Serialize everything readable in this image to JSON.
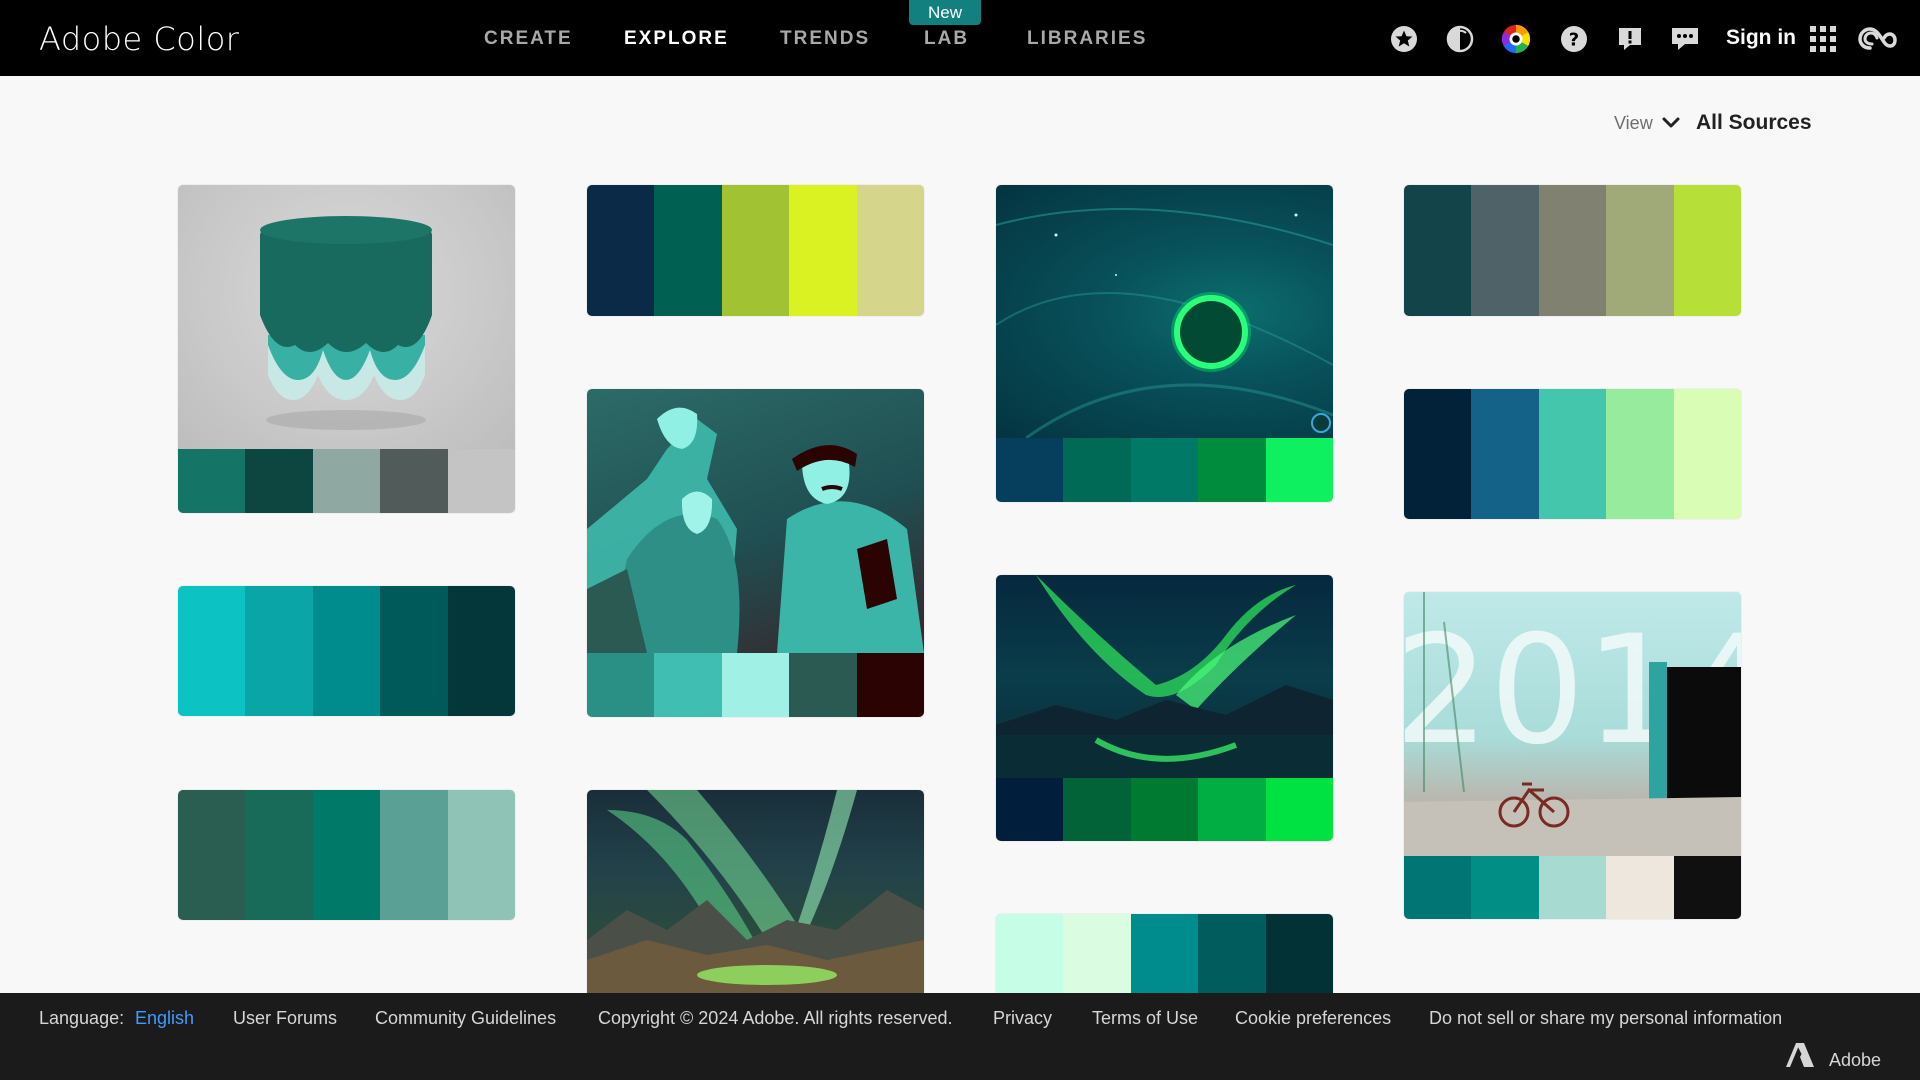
{
  "app": {
    "title": "Adobe Color"
  },
  "nav": {
    "items": [
      {
        "label": "CREATE"
      },
      {
        "label": "EXPLORE"
      },
      {
        "label": "TRENDS"
      },
      {
        "label": "LAB"
      },
      {
        "label": "LIBRARIES"
      }
    ],
    "active": "EXPLORE",
    "lab_badge": "New"
  },
  "header": {
    "icons": [
      "favorites-star-icon",
      "contrast-icon",
      "color-wheel-icon",
      "help-icon",
      "report-icon",
      "feedback-icon"
    ],
    "sign_in": "Sign in"
  },
  "filter": {
    "view_label": "View",
    "source": "All Sources"
  },
  "colors": {
    "background": "#f8f8f8",
    "header": "#000000",
    "footer": "#1b1b1b",
    "badge": "#12807f",
    "link": "#3d9cff"
  },
  "palettes": [
    {
      "image": "teal-stool-render",
      "colors": [
        "#147567",
        "#0d4640",
        "#8fa8a1",
        "#515b5a",
        "#c4c4c4"
      ]
    },
    {
      "image": "",
      "colors": [
        "#0a2a47",
        "#006052",
        "#a1c232",
        "#dbf222",
        "#d5d68c"
      ]
    },
    {
      "image": "green-planet-space",
      "colors": [
        "#063f5e",
        "#006a56",
        "#007a66",
        "#008c3d",
        "#0ef060"
      ]
    },
    {
      "image": "",
      "colors": [
        "#12444a",
        "#4f6267",
        "#808171",
        "#a0aa78",
        "#b6e038"
      ]
    },
    {
      "image": "",
      "colors": [
        "#0dc2c3",
        "#0aa5a6",
        "#008b8d",
        "#005a5a",
        "#04373a"
      ]
    },
    {
      "image": "teal-illustration-men",
      "colors": [
        "#2a8f85",
        "#40beb2",
        "#a0f0e6",
        "#2b5a52",
        "#2a0302"
      ]
    },
    {
      "image": "",
      "colors": [
        "#012238",
        "#156289",
        "#43c6ac",
        "#96eb9c",
        "#dafdb5"
      ]
    },
    {
      "image": "aurora-lake",
      "colors": [
        "#021e3d",
        "#016337",
        "#007931",
        "#00ae44",
        "#00e242"
      ]
    },
    {
      "image": "",
      "colors": [
        "#2a5e50",
        "#186b58",
        "#007968",
        "#5aa094",
        "#8fc3b6"
      ]
    },
    {
      "image": "teal-wall-bicycle",
      "colors": [
        "#017574",
        "#018f85",
        "#a7dbd2",
        "#ede7de",
        "#101010"
      ]
    },
    {
      "image": "aurora-mountains",
      "colors": []
    },
    {
      "image": "",
      "colors": [
        "#c6fde7",
        "#dafde2",
        "#008c8c",
        "#015c5e",
        "#023235"
      ]
    }
  ],
  "footer": {
    "language_label": "Language:",
    "language": "English",
    "links": [
      {
        "label": "User Forums"
      },
      {
        "label": "Community Guidelines"
      },
      {
        "label": "Copyright © 2024 Adobe. All rights reserved."
      },
      {
        "label": "Privacy"
      },
      {
        "label": "Terms of Use"
      },
      {
        "label": "Cookie preferences"
      },
      {
        "label": "Do not sell or share my personal information"
      }
    ],
    "brand": "Adobe"
  }
}
